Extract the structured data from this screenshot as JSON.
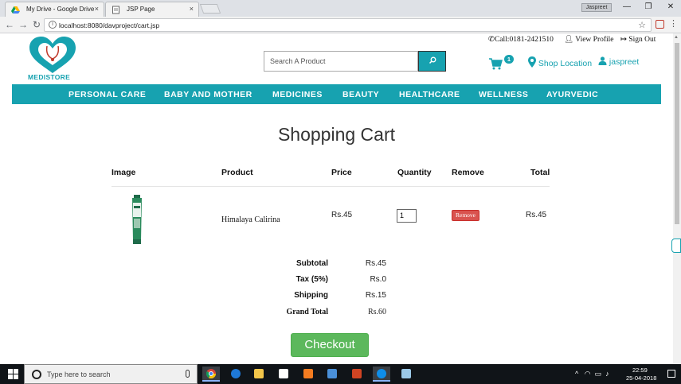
{
  "browser": {
    "tabs": [
      {
        "title": "My Drive - Google Drive",
        "close": "×"
      },
      {
        "title": "JSP Page",
        "close": "×"
      }
    ],
    "profile": "Jaspreet",
    "window_controls": {
      "minimize": "—",
      "restore": "❐",
      "close": "✕"
    },
    "url": "localhost:8080/davproject/cart.jsp",
    "nav": {
      "back": "←",
      "forward": "→",
      "reload": "↻"
    }
  },
  "header": {
    "logo_text": "MEDISTORE",
    "search_placeholder": "Search A Product",
    "phone": "Call:0181-2421510",
    "view_profile": "View Profile",
    "sign_out": "Sign Out",
    "cart_count": "1",
    "shop_location": "Shop Location",
    "user": "jaspreet",
    "accent_color": "#17a2b0"
  },
  "nav_items": [
    "PERSONAL CARE",
    "BABY AND MOTHER",
    "MEDICINES",
    "BEAUTY",
    "HEALTHCARE",
    "WELLNESS",
    "AYURVEDIC"
  ],
  "cart": {
    "title": "Shopping Cart",
    "columns": [
      "Image",
      "Product",
      "Price",
      "Quantity",
      "Remove",
      "Total"
    ],
    "items": [
      {
        "product": "Himalaya Calirina",
        "price": "Rs.45",
        "quantity": "1",
        "remove_label": "Remove",
        "total": "Rs.45"
      }
    ],
    "summary": [
      {
        "label": "Subtotal",
        "value": "Rs.45"
      },
      {
        "label": "Tax (5%)",
        "value": "Rs.0"
      },
      {
        "label": "Shipping",
        "value": "Rs.15"
      },
      {
        "label": "Grand Total",
        "value": "Rs.60"
      }
    ],
    "checkout_label": "Checkout"
  },
  "taskbar": {
    "search_placeholder": "Type here to search",
    "time": "22:59",
    "date": "25-04-2018"
  }
}
